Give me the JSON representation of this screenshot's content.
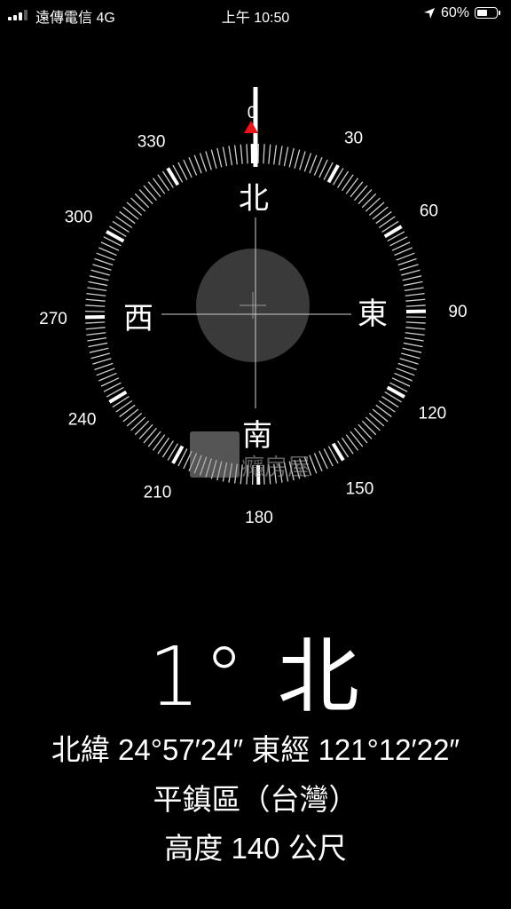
{
  "status_bar": {
    "carrier": "遠傳電信  4G",
    "time": "上午 10:50",
    "battery_percent_text": "60%",
    "battery_level": 0.6,
    "signal_bars": 3,
    "signal_bars_total": 4
  },
  "compass": {
    "degree_labels": [
      "0",
      "30",
      "60",
      "90",
      "120",
      "150",
      "180",
      "210",
      "240",
      "270",
      "300",
      "330"
    ],
    "cardinals": {
      "north": "北",
      "east": "東",
      "south": "南",
      "west": "西"
    },
    "heading_degrees": 1,
    "north_marker_color": "#e8151b"
  },
  "readout": {
    "heading_text": "1° 北",
    "coordinates": "北緯 24°57′24″  東經 121°12′22″",
    "place": "平鎮區（台灣）",
    "elevation": "高度 140 公尺"
  },
  "watermark": {
    "text": "癮房屋"
  }
}
